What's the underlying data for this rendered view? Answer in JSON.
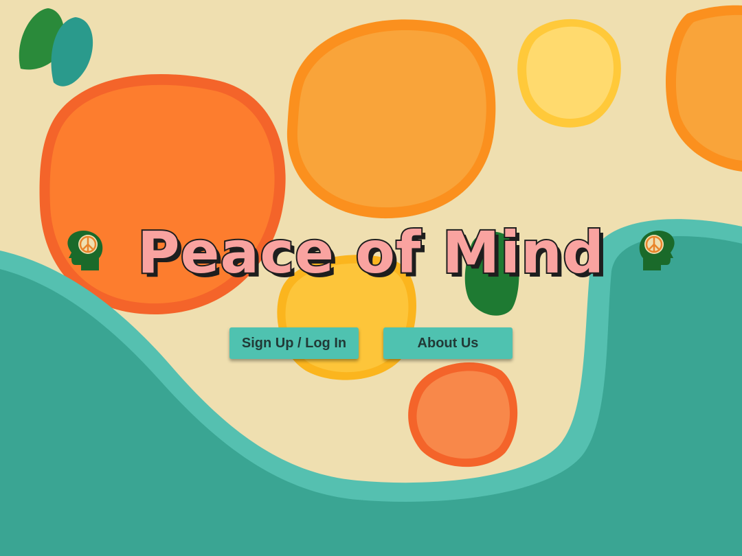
{
  "page": {
    "title": "Peace of Mind"
  },
  "icons": {
    "left": "head-peace-icon",
    "right": "head-peace-icon"
  },
  "actions": {
    "signup_label": "Sign Up / Log In",
    "about_label": "About Us"
  },
  "colors": {
    "background_cream": "#efdfb0",
    "teal": "#3aa593",
    "teal_light": "#55c0b0",
    "orange": "#fd7d2e",
    "orange_light": "#f9a22e",
    "yellow": "#ffd65a",
    "title_pink": "#f9a3a0",
    "icon_green": "#1a6a2a",
    "button": "#4fc2b0"
  }
}
